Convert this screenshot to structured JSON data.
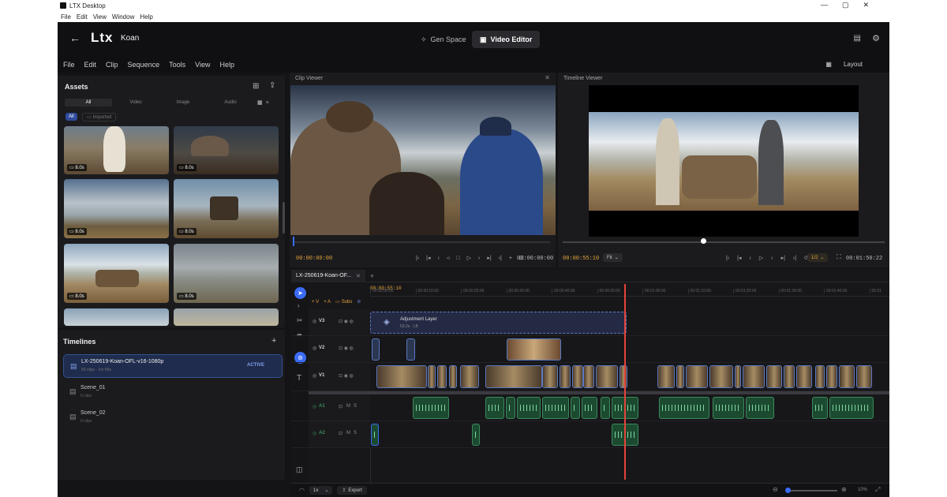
{
  "os": {
    "title": "LTX Desktop",
    "menu": [
      "File",
      "Edit",
      "View",
      "Window",
      "Help"
    ],
    "controls": [
      "—",
      "▢",
      "✕"
    ]
  },
  "header": {
    "logo": "Ltx",
    "project": "Koan",
    "tabs": [
      {
        "label": "Gen Space"
      },
      {
        "label": "Video Editor"
      }
    ]
  },
  "menubar": {
    "items": [
      "File",
      "Edit",
      "Clip",
      "Sequence",
      "Tools",
      "View",
      "Help"
    ],
    "layout_label": "Layout"
  },
  "assets": {
    "title": "Assets",
    "filters": [
      "All",
      "Video",
      "Image",
      "Audio"
    ],
    "chips": {
      "all": "All",
      "imported": "Imported"
    },
    "thumbs": [
      {
        "dur": "8.0s",
        "scene": "goat"
      },
      {
        "dur": "8.0s",
        "scene": "yurt"
      },
      {
        "dur": "8.0s",
        "scene": "clouds"
      },
      {
        "dur": "8.0s",
        "scene": "saddle"
      },
      {
        "dur": "8.0s",
        "scene": "cart"
      },
      {
        "dur": "8.0s",
        "scene": "lake"
      }
    ]
  },
  "timelines_panel": {
    "title": "Timelines",
    "items": [
      {
        "name": "LX-250619-Koan-OFL-v16-1080p",
        "meta": "50 clips · 1m 50s",
        "badge": "ACTIVE"
      },
      {
        "name": "Scene_01",
        "meta": "0 clips",
        "badge": ""
      },
      {
        "name": "Scene_02",
        "meta": "0 clips",
        "badge": ""
      }
    ]
  },
  "clip_viewer": {
    "title": "Clip Viewer",
    "timecode_left": "00:00:00:00",
    "timecode_right": "00:00:00:00"
  },
  "timeline_viewer": {
    "title": "Timeline Viewer",
    "timecode_left": "00:00:55:10",
    "fit": "Fit",
    "quality": "1/2",
    "timecode_right": "00:01:50:22"
  },
  "timeline": {
    "tab": "LX-250619-Koan-OF...",
    "timecode": "00:00:55:10",
    "ruler": [
      "00:00:00:00",
      "00:00:10:00",
      "00:00:20:00",
      "00:00:30:00",
      "00:00:40:00",
      "00:00:50:00",
      "00:01:00:00",
      "00:01:10:00",
      "00:01:20:00",
      "00:01:30:00",
      "00:01:40:00",
      "00:01"
    ],
    "add_v": "+ V",
    "add_a": "+ A",
    "subs": "Subs",
    "tracks": {
      "v3": "V3",
      "v2": "V2",
      "v1": "V1",
      "a1": "A1",
      "a2": "A2"
    },
    "ms": {
      "m": "M",
      "s": "S"
    },
    "adjustment_layer": {
      "title": "Adjustment Layer",
      "meta": "59.2s · LB"
    },
    "speed": "1x",
    "export": "Export",
    "zoom": "10%"
  },
  "colors": {
    "accent": "#3b6cf6",
    "playhead": "#e5443a",
    "video_clip": "#5a79c0",
    "audio_clip": "#3b8a5b",
    "bg": "#141416"
  }
}
